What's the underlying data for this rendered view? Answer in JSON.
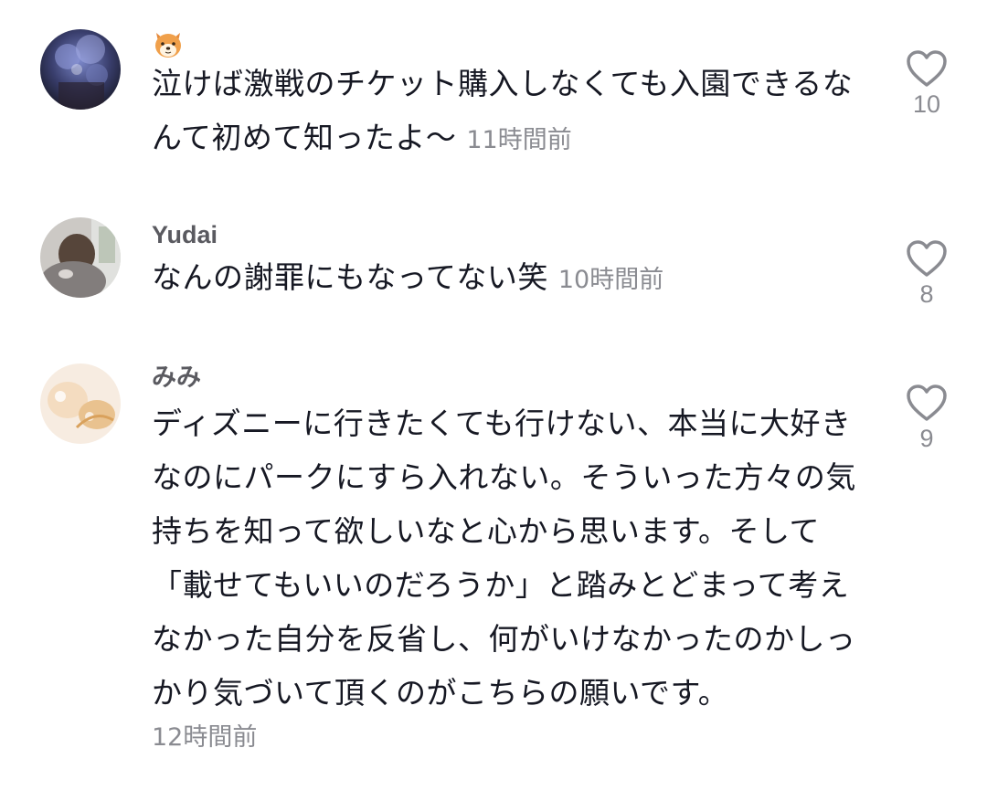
{
  "comments": [
    {
      "username": "",
      "username_icon": "shiba-dog-emoji-icon",
      "text": "泣けば激戦のチケット購入しなくても入園できるなんて初めて知ったよ〜",
      "time": "11時間前",
      "likes": "10"
    },
    {
      "username": "Yudai",
      "text": "なんの謝罪にもなってない笑",
      "time": "10時間前",
      "likes": "8"
    },
    {
      "username": "みみ",
      "text": "ディズニーに行きたくても行けない、本当に大好きなのにパークにすら入れない。そういった方々の気持ちを知って欲しいなと心から思います。そして「載せてもいいのだろうか」と踏みとどまって考えなかった自分を反省し、何がいけなかったのかしっかり気づいて頂くのがこちらの願いです。",
      "time": "12時間前",
      "likes": "9"
    }
  ],
  "colors": {
    "text": "#161823",
    "secondary": "#8a8b91",
    "username": "#5a5a60",
    "heart_outline": "#8a8b91"
  }
}
